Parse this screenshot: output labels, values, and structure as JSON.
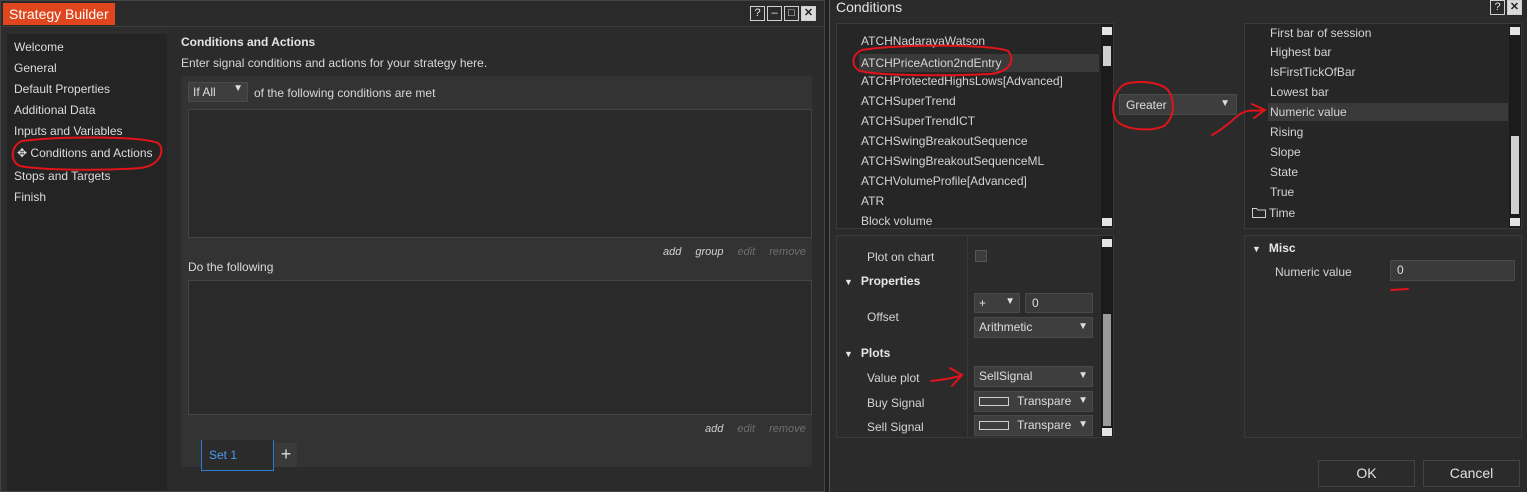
{
  "left_window": {
    "title": "Strategy Builder",
    "controls": [
      "?",
      "–",
      "□",
      "✕"
    ],
    "nav": [
      "Welcome",
      "General",
      "Default Properties",
      "Additional Data",
      "Inputs and Variables",
      "Conditions and Actions",
      "Stops and Targets",
      "Finish"
    ],
    "active_nav_index": 5,
    "active_marker": "✥",
    "heading": "Conditions and Actions",
    "subheading": "Enter signal conditions and actions for your strategy here.",
    "if_select": "If All",
    "condition_text": "of the following conditions are met",
    "cond_actions": [
      "add",
      "group",
      "edit",
      "remove"
    ],
    "do_text": "Do the following",
    "do_actions": [
      "add",
      "edit",
      "remove"
    ],
    "set_tab": "Set 1",
    "add_tab": "+"
  },
  "right_window": {
    "title": "Conditions",
    "controls": [
      "?",
      "✕"
    ],
    "indicators": [
      "ATCHNadarayaWatson",
      "ATCHPriceAction2ndEntry",
      "ATCHProtectedHighsLows[Advanced]",
      "ATCHSuperTrend",
      "ATCHSuperTrendICT",
      "ATCHSwingBreakoutSequence",
      "ATCHSwingBreakoutSequenceML",
      "ATCHVolumeProfile[Advanced]",
      "ATR",
      "Block volume"
    ],
    "selected_indicator_index": 1,
    "operator": "Greater",
    "right_items": [
      "First bar of session",
      "Highest bar",
      "IsFirstTickOfBar",
      "Lowest bar",
      "Numeric value",
      "Rising",
      "Slope",
      "State",
      "True",
      "Time"
    ],
    "selected_right_index": 4,
    "props": {
      "plot_on_chart": "Plot on chart",
      "properties": "Properties",
      "offset_label": "Offset",
      "offset_sign": "+",
      "offset_value": "0",
      "offset_type": "Arithmetic",
      "plots": "Plots",
      "value_plot_label": "Value plot",
      "value_plot": "SellSignal",
      "buy_label": "Buy Signal",
      "buy_value": "Transpare",
      "sell_label": "Sell Signal",
      "sell_value": "Transpare"
    },
    "misc": {
      "section": "Misc",
      "label": "Numeric value",
      "value": "0"
    },
    "ok": "OK",
    "cancel": "Cancel"
  },
  "colors": {
    "accent_orange": "#e0461e",
    "tab_blue": "#2d7bd4",
    "annotation_red": "#e0141a"
  }
}
